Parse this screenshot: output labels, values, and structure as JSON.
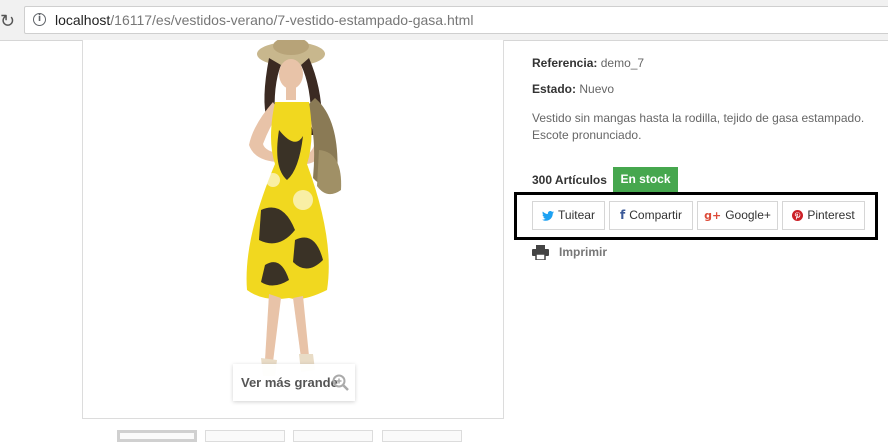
{
  "browser": {
    "url_host": "localhost",
    "url_path": "/16117/es/vestidos-verano/7-vestido-estampado-gasa.html",
    "info_icon_glyph": "i"
  },
  "product_image": {
    "zoom_label": "Ver más grande"
  },
  "product": {
    "reference_label": "Referencia:",
    "reference_value": "demo_7",
    "condition_label": "Estado:",
    "condition_value": "Nuevo",
    "description": "Vestido sin mangas hasta la rodilla, tejido de gasa estampado. Escote pronunciado.",
    "quantity_text": "300 Artículos",
    "stock_label": "En stock",
    "stock_color": "#46a74e"
  },
  "share": {
    "tweet_label": "Tuitear",
    "share_label": "Compartir",
    "google_label": "Google+",
    "pinterest_label": "Pinterest",
    "twitter_color": "#1da1f2",
    "facebook_color": "#3b5998",
    "google_color": "#dd4b39",
    "pinterest_color": "#cb2027"
  },
  "print": {
    "label": "Imprimir"
  }
}
